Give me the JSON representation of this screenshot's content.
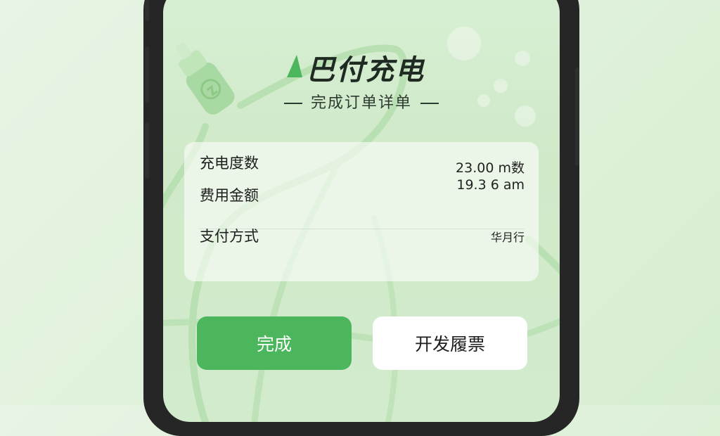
{
  "app": {
    "logo_text": "巴付充电",
    "subtitle": "完成订单详单"
  },
  "order": {
    "rows": [
      {
        "label": "充电度数",
        "value": "23.00 m数"
      },
      {
        "label": "费用金额",
        "value": "19.3 6 am"
      },
      {
        "label": "支付方式",
        "value": "华月行"
      }
    ]
  },
  "buttons": {
    "done_label": "完成",
    "invoice_label": "开发履票"
  },
  "colors": {
    "accent_green": "#4cb65c",
    "background": "#dff1da",
    "phone_frame": "#262626"
  }
}
